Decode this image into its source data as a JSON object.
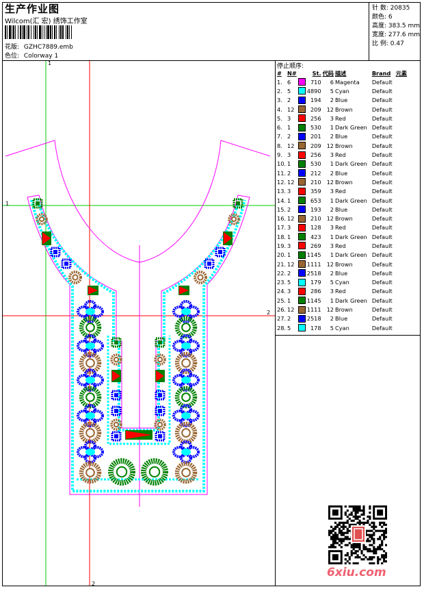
{
  "header": {
    "title": "生产作业图",
    "company": "Wilcom(汇 宏) 绣饰工作室",
    "pattern_label": "花版:",
    "pattern_value": "GZHC7889.emb",
    "colorway_label": "色位:",
    "colorway_value": "Colorway 1"
  },
  "stats": {
    "stitches": "针 数: 20835",
    "colors": "颜色: 6",
    "height": "高度: 383.5 mm",
    "width": "宽度: 277.6 mm",
    "scale": "比 例: 0.47"
  },
  "sequence": {
    "title": "停止顺序:",
    "headers": [
      "#",
      "N#",
      "St.",
      "代码",
      "描述",
      "Brand",
      "元素"
    ],
    "rows": [
      {
        "idx": "1.",
        "n": "6",
        "color": "#ff00ff",
        "st": "710",
        "code": "6",
        "desc": "Magenta",
        "brand": "Default"
      },
      {
        "idx": "2.",
        "n": "5",
        "color": "#00ffff",
        "st": "4890",
        "code": "5",
        "desc": "Cyan",
        "brand": "Default"
      },
      {
        "idx": "3.",
        "n": "2",
        "color": "#0000ff",
        "st": "194",
        "code": "2",
        "desc": "Blue",
        "brand": "Default"
      },
      {
        "idx": "4.",
        "n": "12",
        "color": "#996633",
        "st": "209",
        "code": "12",
        "desc": "Brown",
        "brand": "Default"
      },
      {
        "idx": "5.",
        "n": "3",
        "color": "#ff0000",
        "st": "256",
        "code": "3",
        "desc": "Red",
        "brand": "Default"
      },
      {
        "idx": "6.",
        "n": "1",
        "color": "#008000",
        "st": "530",
        "code": "1",
        "desc": "Dark Green",
        "brand": "Default"
      },
      {
        "idx": "7.",
        "n": "2",
        "color": "#0000ff",
        "st": "201",
        "code": "2",
        "desc": "Blue",
        "brand": "Default"
      },
      {
        "idx": "8.",
        "n": "12",
        "color": "#996633",
        "st": "209",
        "code": "12",
        "desc": "Brown",
        "brand": "Default"
      },
      {
        "idx": "9.",
        "n": "3",
        "color": "#ff0000",
        "st": "256",
        "code": "3",
        "desc": "Red",
        "brand": "Default"
      },
      {
        "idx": "10.",
        "n": "1",
        "color": "#008000",
        "st": "530",
        "code": "1",
        "desc": "Dark Green",
        "brand": "Default"
      },
      {
        "idx": "11.",
        "n": "2",
        "color": "#0000ff",
        "st": "212",
        "code": "2",
        "desc": "Blue",
        "brand": "Default"
      },
      {
        "idx": "12.",
        "n": "12",
        "color": "#996633",
        "st": "210",
        "code": "12",
        "desc": "Brown",
        "brand": "Default"
      },
      {
        "idx": "13.",
        "n": "3",
        "color": "#ff0000",
        "st": "359",
        "code": "3",
        "desc": "Red",
        "brand": "Default"
      },
      {
        "idx": "14.",
        "n": "1",
        "color": "#008000",
        "st": "653",
        "code": "1",
        "desc": "Dark Green",
        "brand": "Default"
      },
      {
        "idx": "15.",
        "n": "2",
        "color": "#0000ff",
        "st": "193",
        "code": "2",
        "desc": "Blue",
        "brand": "Default"
      },
      {
        "idx": "16.",
        "n": "12",
        "color": "#996633",
        "st": "210",
        "code": "12",
        "desc": "Brown",
        "brand": "Default"
      },
      {
        "idx": "17.",
        "n": "3",
        "color": "#ff0000",
        "st": "128",
        "code": "3",
        "desc": "Red",
        "brand": "Default"
      },
      {
        "idx": "18.",
        "n": "1",
        "color": "#008000",
        "st": "423",
        "code": "1",
        "desc": "Dark Green",
        "brand": "Default"
      },
      {
        "idx": "19.",
        "n": "3",
        "color": "#ff0000",
        "st": "269",
        "code": "3",
        "desc": "Red",
        "brand": "Default"
      },
      {
        "idx": "20.",
        "n": "1",
        "color": "#008000",
        "st": "1145",
        "code": "1",
        "desc": "Dark Green",
        "brand": "Default"
      },
      {
        "idx": "21.",
        "n": "12",
        "color": "#996633",
        "st": "1111",
        "code": "12",
        "desc": "Brown",
        "brand": "Default"
      },
      {
        "idx": "22.",
        "n": "2",
        "color": "#0000ff",
        "st": "2518",
        "code": "2",
        "desc": "Blue",
        "brand": "Default"
      },
      {
        "idx": "23.",
        "n": "5",
        "color": "#00ffff",
        "st": "179",
        "code": "5",
        "desc": "Cyan",
        "brand": "Default"
      },
      {
        "idx": "24.",
        "n": "3",
        "color": "#ff0000",
        "st": "286",
        "code": "3",
        "desc": "Red",
        "brand": "Default"
      },
      {
        "idx": "25.",
        "n": "1",
        "color": "#008000",
        "st": "1145",
        "code": "1",
        "desc": "Dark Green",
        "brand": "Default"
      },
      {
        "idx": "26.",
        "n": "12",
        "color": "#996633",
        "st": "1111",
        "code": "12",
        "desc": "Brown",
        "brand": "Default"
      },
      {
        "idx": "27.",
        "n": "2",
        "color": "#0000ff",
        "st": "2518",
        "code": "2",
        "desc": "Blue",
        "brand": "Default"
      },
      {
        "idx": "28.",
        "n": "5",
        "color": "#00ffff",
        "st": "178",
        "code": "5",
        "desc": "Cyan",
        "brand": "Default"
      }
    ]
  },
  "guides": {
    "v1": "1",
    "h1": "1",
    "v2": "2",
    "h2": "2"
  },
  "watermark": "6xiu.com",
  "colors": {
    "magenta": "#ff00ff",
    "cyan": "#00ffff",
    "blue": "#0000ff",
    "brown": "#996633",
    "red": "#ff0000",
    "green": "#008000",
    "guide_green": "#00cc00",
    "guide_red": "#ff0000"
  }
}
